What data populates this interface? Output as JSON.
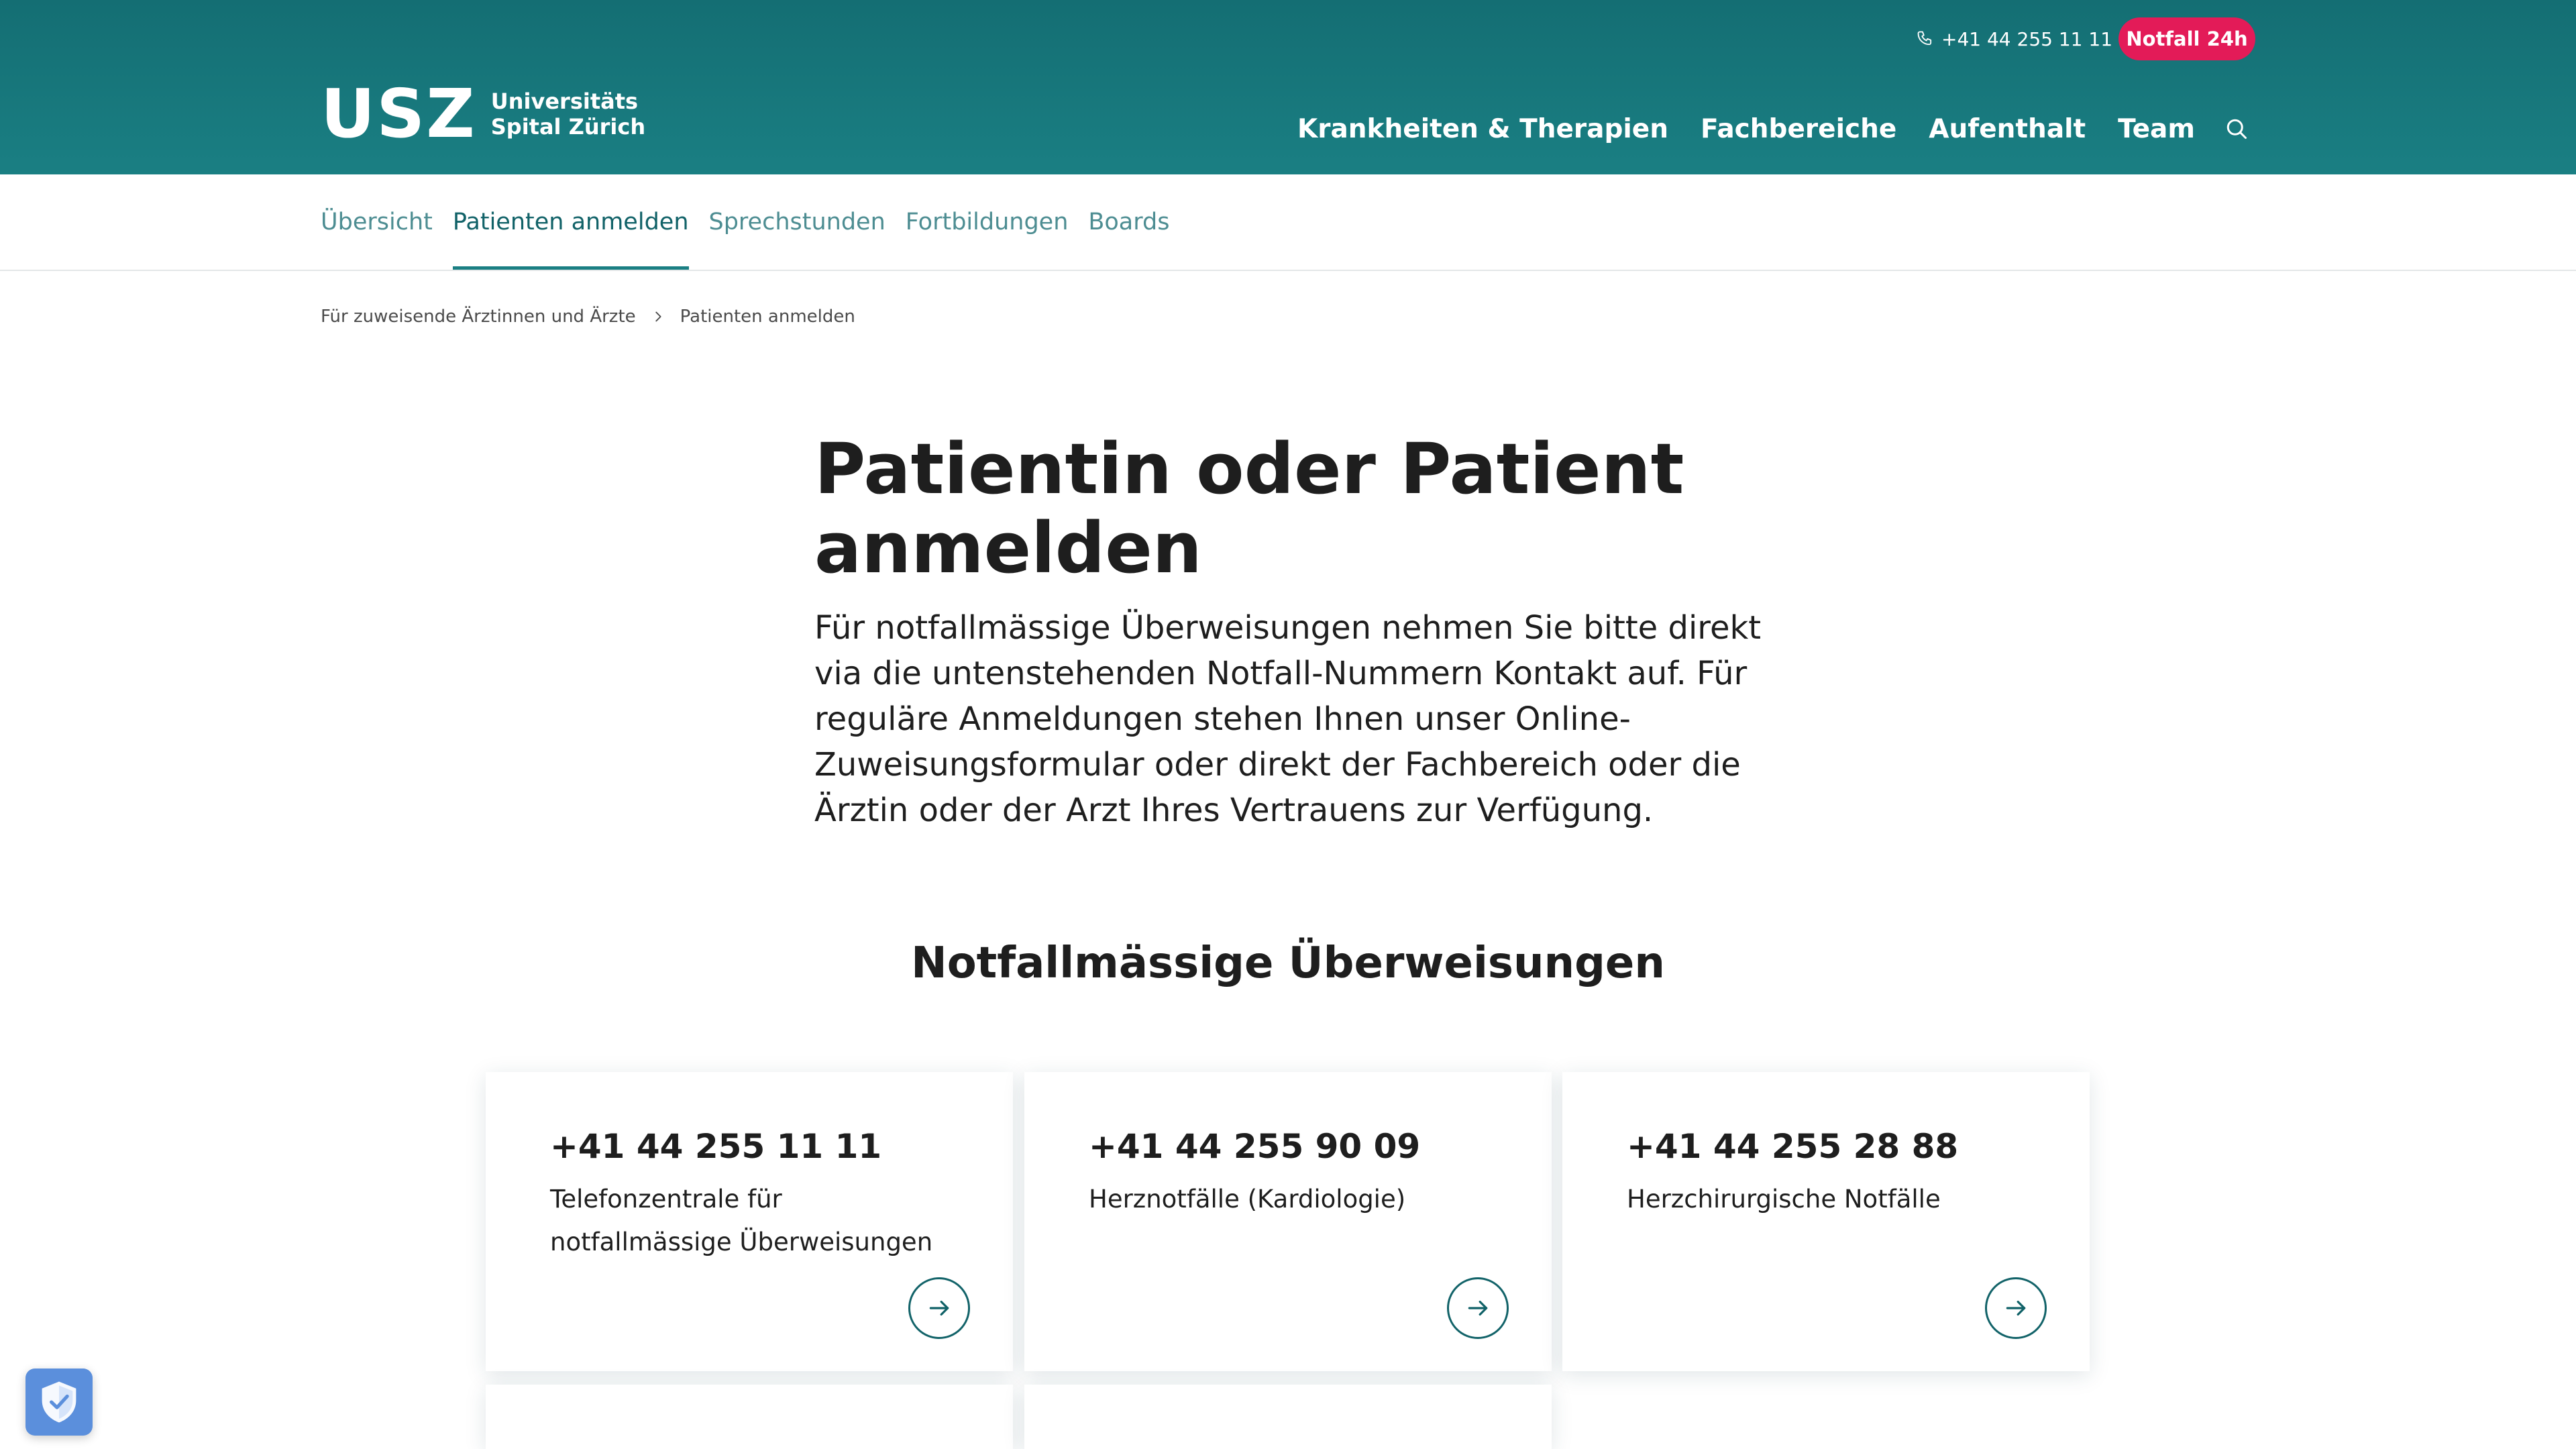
{
  "header": {
    "logo_mark": "USZ",
    "logo_line1": "Universitäts",
    "logo_line2": "Spital Zürich",
    "phone": "+41 44 255 11 11",
    "emergency_button": "Notfall 24h",
    "nav": [
      "Krankheiten & Therapien",
      "Fachbereiche",
      "Aufenthalt",
      "Team"
    ],
    "colors": {
      "header_bg": "#1a7f83",
      "emergency": "#e31b58"
    }
  },
  "subnav": {
    "items": [
      "Übersicht",
      "Patienten anmelden",
      "Sprechstunden",
      "Fortbildungen",
      "Boards"
    ],
    "active_index": 1
  },
  "breadcrumb": {
    "items": [
      "Für zuweisende Ärztinnen und Ärzte",
      "Patienten anmelden"
    ]
  },
  "main": {
    "title": "Patientin oder Patient anmelden",
    "intro": "Für notfallmässige Überweisungen nehmen Sie bitte direkt via die untenstehenden Notfall-Nummern Kontakt auf. Für reguläre Anmeldungen stehen Ihnen unser Online-Zuweisungsformular oder direkt der Fachbereich oder die Ärztin oder der Arzt Ihres Vertrauens zur Verfügung.",
    "section_title": "Notfallmässige Überweisungen"
  },
  "cards": [
    {
      "phone": "+41 44 255 11 11",
      "description": "Telefonzentrale für notfallmässige Überweisungen"
    },
    {
      "phone": "+41 44 255 90 09",
      "description": "Herznotfälle (Kardiologie)"
    },
    {
      "phone": "+41 44 255 28 88",
      "description": "Herzchirurgische Notfälle"
    }
  ],
  "icons": {
    "phone": "phone-icon",
    "search": "search-icon",
    "breadcrumb_separator": "chevron-right-icon",
    "card_link": "arrow-right-icon",
    "privacy": "shield-check-icon"
  }
}
